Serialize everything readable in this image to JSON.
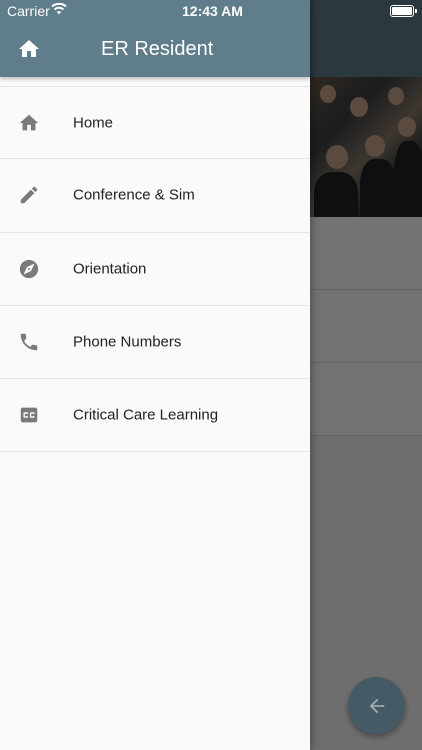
{
  "status_bar": {
    "carrier": "Carrier",
    "time": "12:43 AM"
  },
  "drawer": {
    "title": "ER Resident",
    "items": [
      {
        "label": "Home",
        "icon": "home-icon"
      },
      {
        "label": "Conference & Sim",
        "icon": "pencil-icon"
      },
      {
        "label": "Orientation",
        "icon": "compass-icon"
      },
      {
        "label": "Phone Numbers",
        "icon": "phone-icon"
      },
      {
        "label": "Critical Care Learning",
        "icon": "closed-caption-icon"
      }
    ]
  },
  "fab": {
    "icon": "arrow-back-icon"
  },
  "colors": {
    "header": "#607d8b",
    "fab": "#455a64",
    "icon": "#7a7a7a"
  }
}
